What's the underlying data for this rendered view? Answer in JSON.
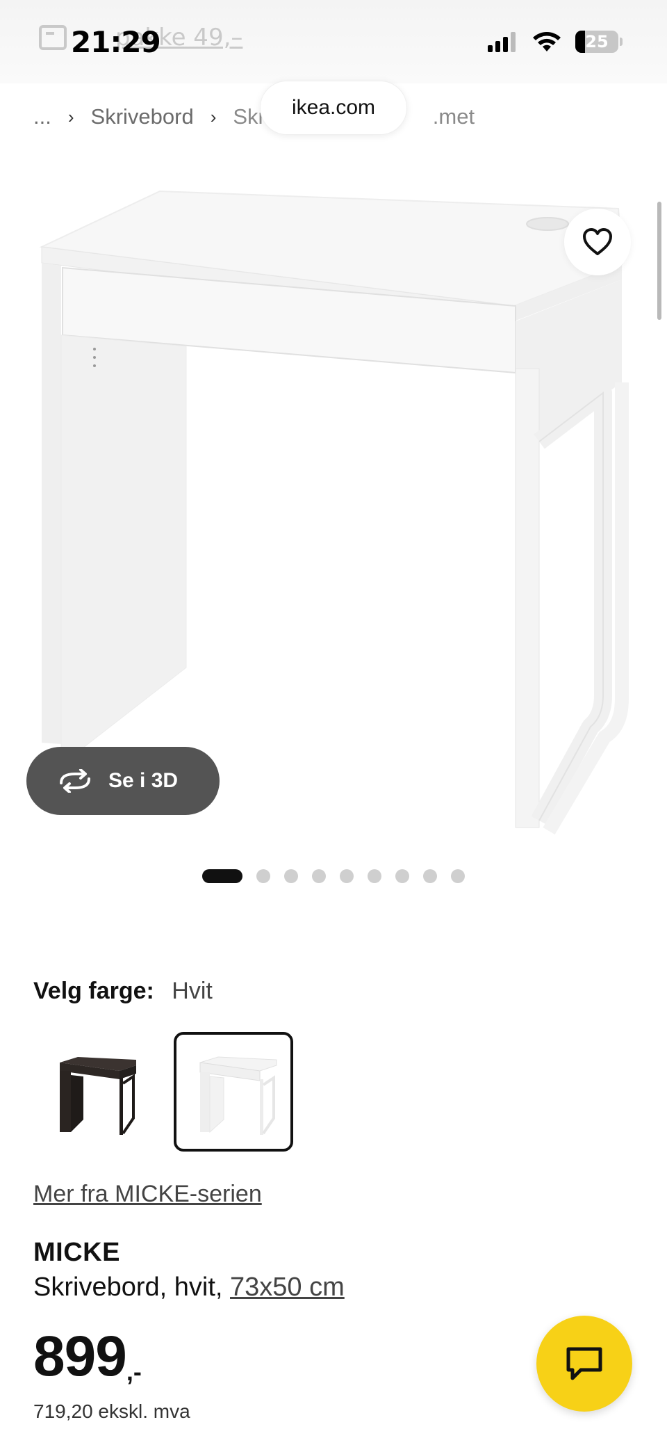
{
  "status_bar": {
    "time": "21:29",
    "battery": "25",
    "promo_text": "pakke 49,–"
  },
  "browser": {
    "url": "ikea.com"
  },
  "breadcrumb": {
    "items": [
      "...",
      "Skrivebord",
      "Skri",
      ".met"
    ]
  },
  "media": {
    "see_3d_label": "Se i 3D",
    "image_count": 9,
    "active_index": 0
  },
  "colour": {
    "label": "Velg farge:",
    "selected": "Hvit",
    "options": [
      "black-brown",
      "white"
    ]
  },
  "series_link": "Mer fra MICKE-serien",
  "product": {
    "name": "MICKE",
    "description": "Skrivebord, hvit,",
    "dimensions": "73x50 cm",
    "price": "899",
    "price_suffix": ",-",
    "price_ex_vat": "719,20 ekskl. mva"
  },
  "colors": {
    "chat_button": "#f7d117",
    "see_3d_bg": "#545454",
    "active_dot": "#111111"
  }
}
